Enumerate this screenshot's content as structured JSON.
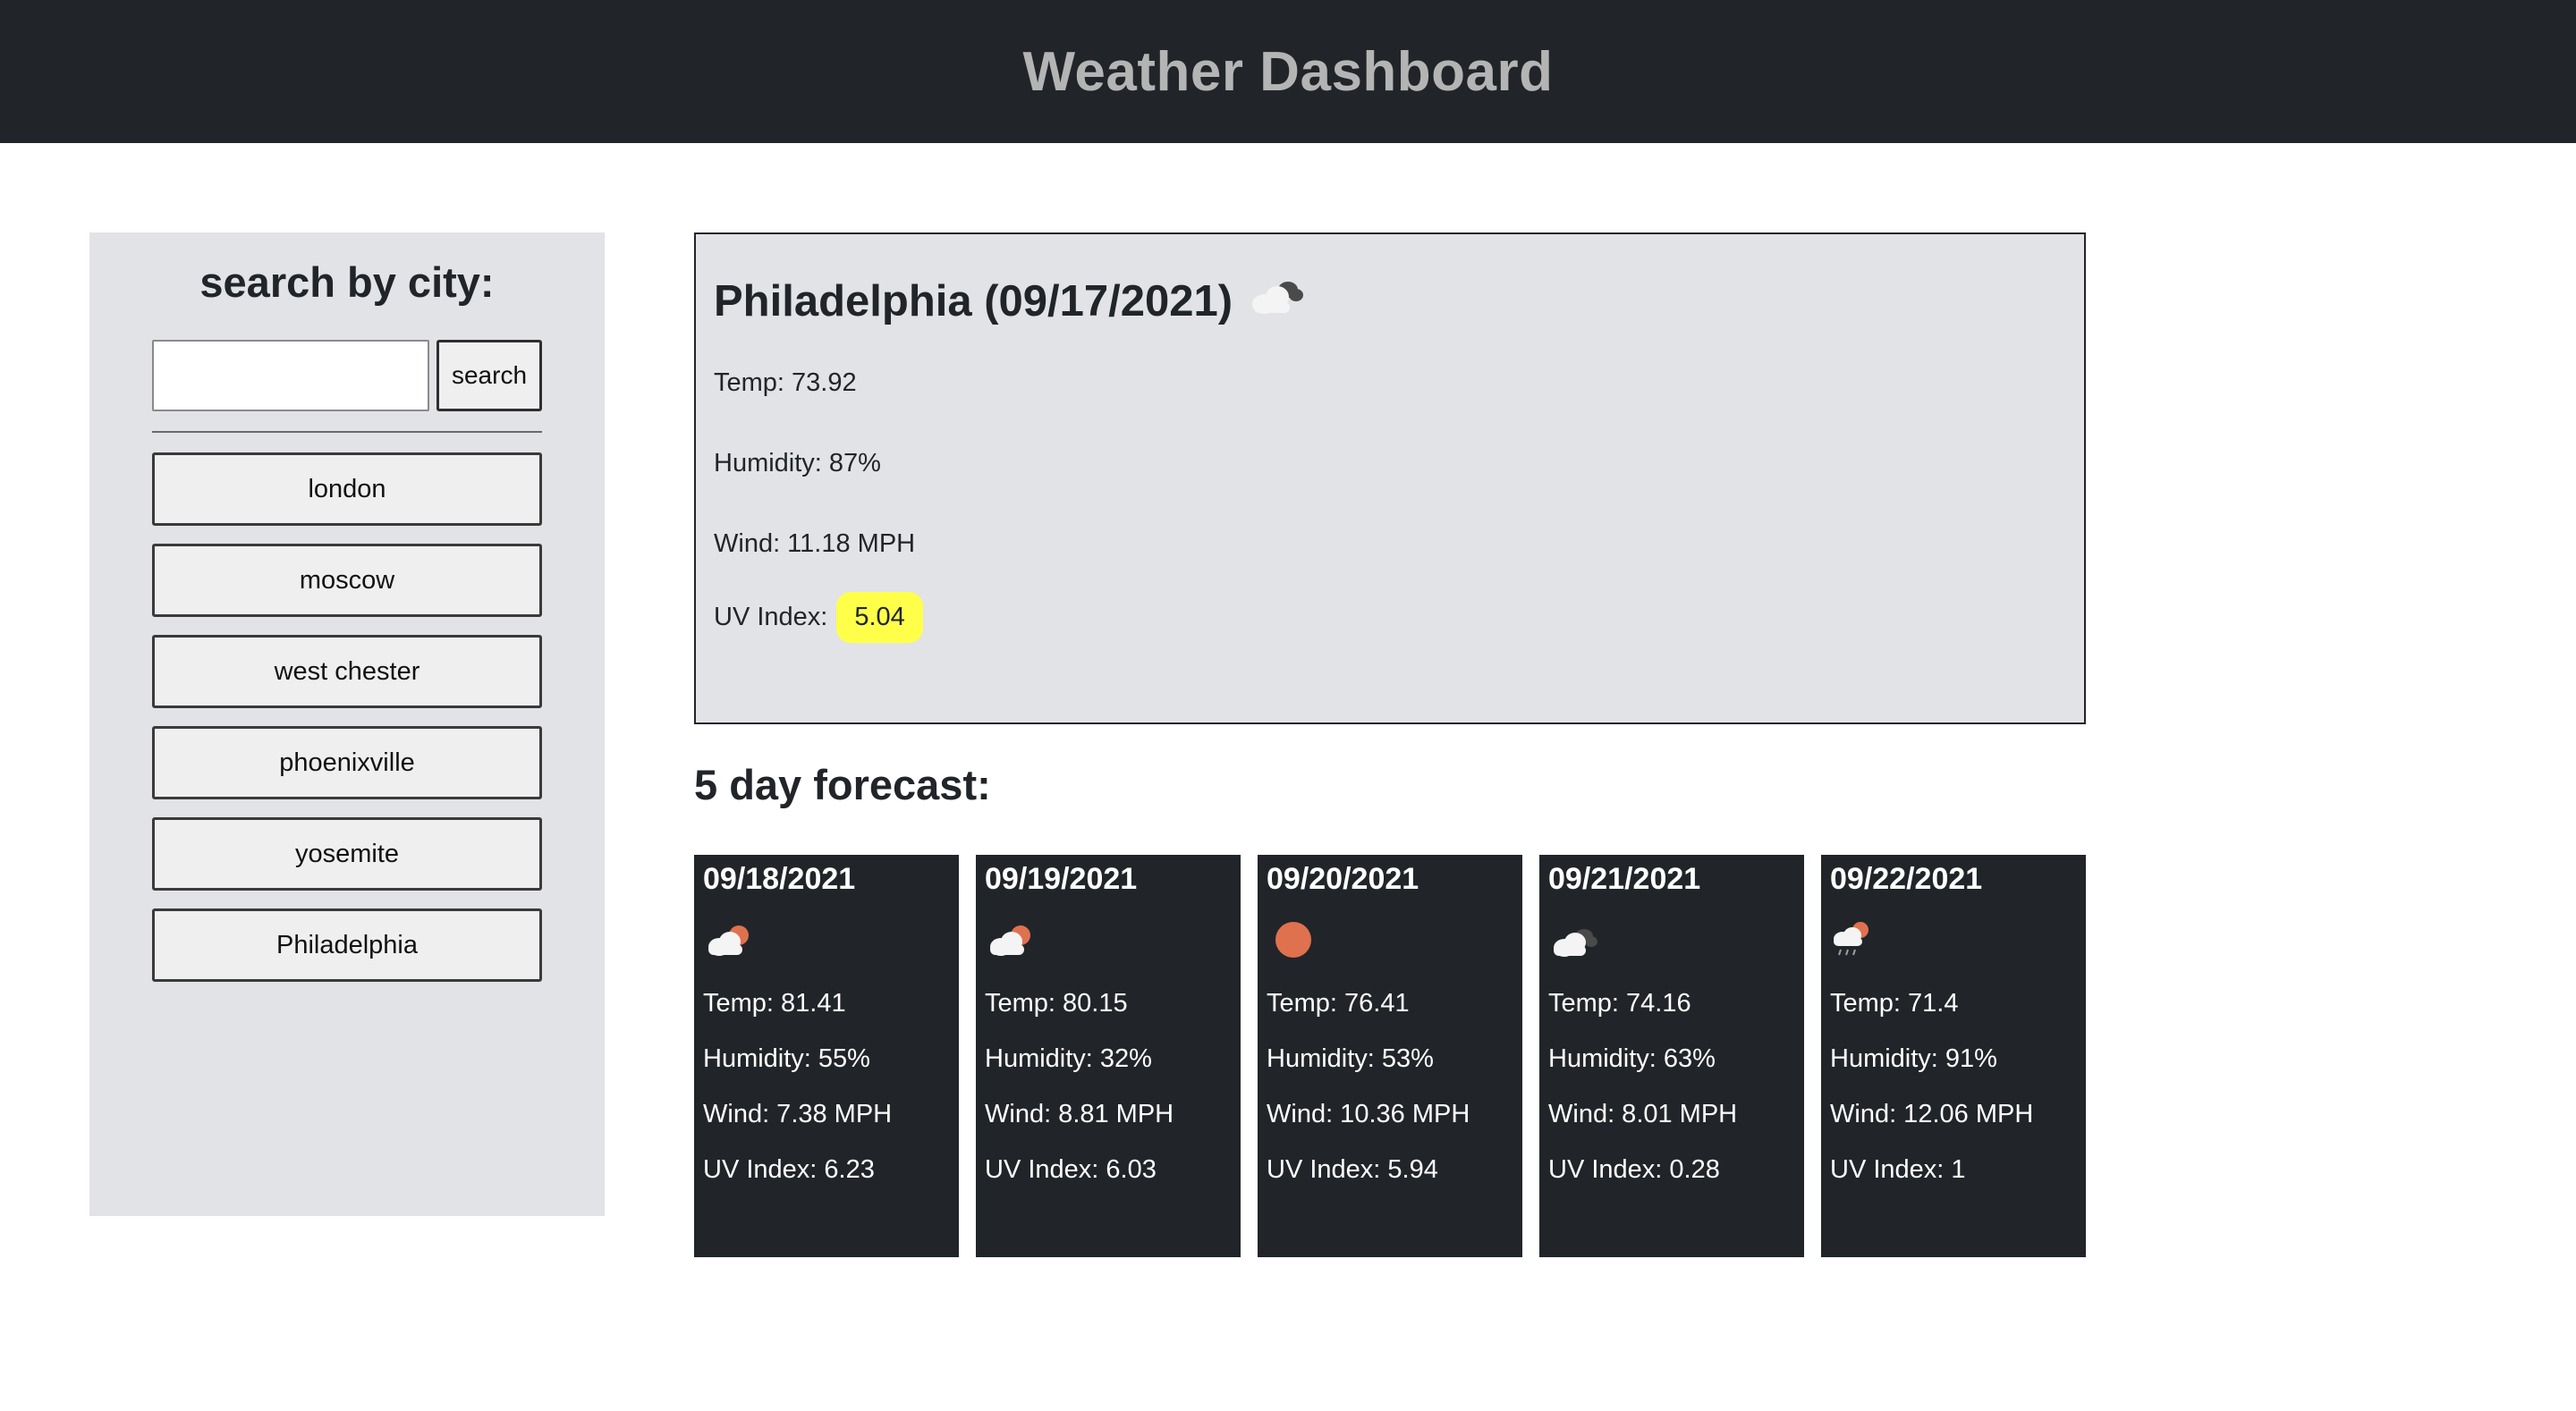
{
  "header": {
    "title": "Weather Dashboard"
  },
  "sidebar": {
    "heading": "search by city:",
    "search_placeholder": "",
    "search_value": "",
    "search_button": "search",
    "history": [
      "london",
      "moscow",
      "west chester",
      "phoenixville",
      "yosemite",
      "Philadelphia"
    ]
  },
  "current": {
    "title": "Philadelphia (09/17/2021)",
    "icon": "cloudy-icon",
    "temp": "Temp: 73.92",
    "humidity": "Humidity: 87%",
    "wind": "Wind: 11.18 MPH",
    "uv_label": "UV Index:",
    "uv_value": "5.04",
    "uv_color": "#ffff4a"
  },
  "forecast": {
    "heading": "5 day forecast:",
    "days": [
      {
        "date": "09/18/2021",
        "icon": "partly-cloudy-icon",
        "temp": "Temp: 81.41",
        "humidity": "Humidity: 55%",
        "wind": "Wind: 7.38 MPH",
        "uv": "UV Index: 6.23"
      },
      {
        "date": "09/19/2021",
        "icon": "partly-cloudy-icon",
        "temp": "Temp: 80.15",
        "humidity": "Humidity: 32%",
        "wind": "Wind: 8.81 MPH",
        "uv": "UV Index: 6.03"
      },
      {
        "date": "09/20/2021",
        "icon": "sun-icon",
        "temp": "Temp: 76.41",
        "humidity": "Humidity: 53%",
        "wind": "Wind: 10.36 MPH",
        "uv": "UV Index: 5.94"
      },
      {
        "date": "09/21/2021",
        "icon": "cloudy-icon",
        "temp": "Temp: 74.16",
        "humidity": "Humidity: 63%",
        "wind": "Wind: 8.01 MPH",
        "uv": "UV Index: 0.28"
      },
      {
        "date": "09/22/2021",
        "icon": "rain-icon",
        "temp": "Temp: 71.4",
        "humidity": "Humidity: 91%",
        "wind": "Wind: 12.06 MPH",
        "uv": "UV Index: 1"
      }
    ]
  },
  "colors": {
    "header_bg": "#212529",
    "header_text": "#b4b4b4",
    "panel_bg": "#e2e3e6",
    "card_bg": "#212529",
    "sun": "#e0714f"
  }
}
